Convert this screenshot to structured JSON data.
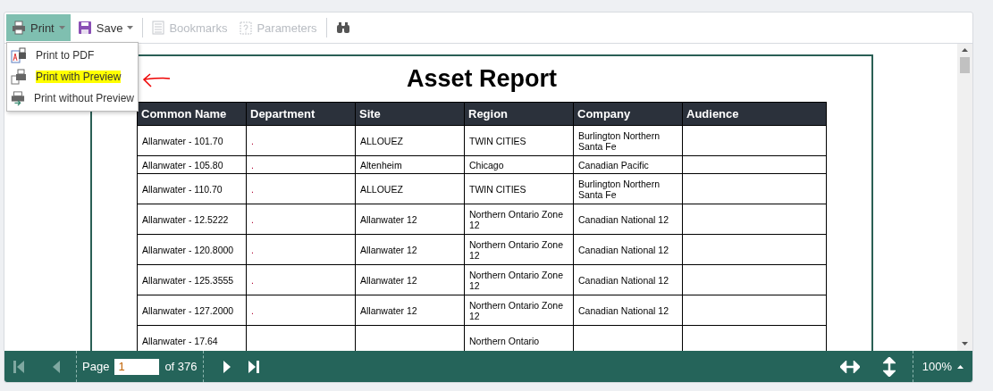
{
  "toolbar": [
    {
      "kind": "menu",
      "label": "Print",
      "active": true,
      "disabled": false
    },
    {
      "kind": "menu",
      "label": "Save",
      "active": false,
      "disabled": false
    },
    {
      "kind": "button",
      "label": "Bookmarks",
      "active": false,
      "disabled": true
    },
    {
      "kind": "button",
      "label": "Parameters",
      "active": false,
      "disabled": true
    },
    {
      "kind": "icon",
      "active": false,
      "disabled": false
    }
  ],
  "print_menu": [
    {
      "label": "Print to PDF",
      "highlighted": false
    },
    {
      "label": "Print with Preview",
      "highlighted": true
    },
    {
      "label": "Print without Preview",
      "highlighted": false
    }
  ],
  "report": {
    "title": "Asset Report",
    "columns": [
      "Common Name",
      "Department",
      "Site",
      "Region",
      "Company",
      "Audience"
    ],
    "rows": [
      [
        "Allanwater - 101.70",
        ".",
        "ALLOUEZ",
        "TWIN CITIES",
        "Burlington Northern Santa Fe",
        ""
      ],
      [
        "Allanwater - 105.80",
        ".",
        "Altenheim",
        "Chicago",
        "Canadian Pacific",
        ""
      ],
      [
        "Allanwater - 110.70",
        ".",
        "ALLOUEZ",
        "TWIN CITIES",
        "Burlington Northern Santa Fe",
        ""
      ],
      [
        "Allanwater - 12.5222",
        ".",
        "Allanwater 12",
        "Northern Ontario Zone 12",
        "Canadian National 12",
        ""
      ],
      [
        "Allanwater - 120.8000",
        ".",
        "Allanwater 12",
        "Northern Ontario Zone 12",
        "Canadian National 12",
        ""
      ],
      [
        "Allanwater - 125.3555",
        ".",
        "Allanwater 12",
        "Northern Ontario Zone 12",
        "Canadian National 12",
        ""
      ],
      [
        "Allanwater - 127.2000",
        ".",
        "Allanwater 12",
        "Northern Ontario Zone 12",
        "Canadian National 12",
        ""
      ],
      [
        "Allanwater - 17.64",
        "",
        "",
        "Northern Ontario",
        "",
        ""
      ]
    ]
  },
  "pager": {
    "first_disabled": true,
    "prev_disabled": true,
    "page_label": "Page",
    "page": "1",
    "of_label": "of 376",
    "zoom": "100%"
  }
}
